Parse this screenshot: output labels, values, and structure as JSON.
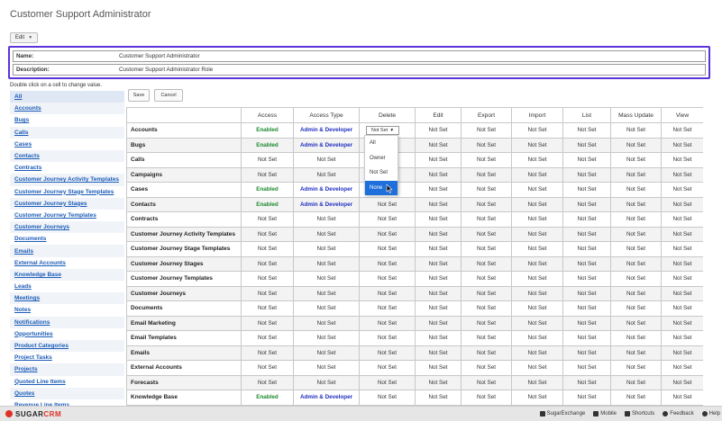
{
  "page_title": "Customer Support Administrator",
  "edit_button": {
    "label": "Edit"
  },
  "role": {
    "name_label": "Name:",
    "name_value": "Customer Support Administrator",
    "description_label": "Description:",
    "description_value": "Customer Support Administrator Role"
  },
  "hint": "Double click on a cell to change value.",
  "actions": {
    "save": "Save",
    "cancel": "Cancel"
  },
  "sidebar": {
    "items": [
      "All",
      "Accounts",
      "Bugs",
      "Calls",
      "Cases",
      "Contacts",
      "Contracts",
      "Customer Journey Activity Templates",
      "Customer Journey Stage Templates",
      "Customer Journey Stages",
      "Customer Journey Templates",
      "Customer Journeys",
      "Documents",
      "Emails",
      "External Accounts",
      "Knowledge Base",
      "Leads",
      "Meetings",
      "Notes",
      "Notifications",
      "Opportunities",
      "Product Categories",
      "Project Tasks",
      "Projects",
      "Quoted Line Items",
      "Quotes",
      "Revenue Line Items"
    ]
  },
  "grid": {
    "columns": [
      "",
      "Access",
      "Access Type",
      "Delete",
      "Edit",
      "Export",
      "Import",
      "List",
      "Mass Update",
      "View"
    ],
    "rows": [
      [
        "Accounts",
        "Enabled",
        "Admin & Developer",
        "",
        "Not Set",
        "Not Set",
        "Not Set",
        "Not Set",
        "Not Set",
        "Not Set"
      ],
      [
        "Bugs",
        "Enabled",
        "Admin & Developer",
        "",
        "Not Set",
        "Not Set",
        "Not Set",
        "Not Set",
        "Not Set",
        "Not Set"
      ],
      [
        "Calls",
        "Not Set",
        "Not Set",
        "",
        "Not Set",
        "Not Set",
        "Not Set",
        "Not Set",
        "Not Set",
        "Not Set"
      ],
      [
        "Campaigns",
        "Not Set",
        "Not Set",
        "",
        "Not Set",
        "Not Set",
        "Not Set",
        "Not Set",
        "Not Set",
        "Not Set"
      ],
      [
        "Cases",
        "Enabled",
        "Admin & Developer",
        "",
        "Not Set",
        "Not Set",
        "Not Set",
        "Not Set",
        "Not Set",
        "Not Set"
      ],
      [
        "Contacts",
        "Enabled",
        "Admin & Developer",
        "Not Set",
        "Not Set",
        "Not Set",
        "Not Set",
        "Not Set",
        "Not Set",
        "Not Set"
      ],
      [
        "Contracts",
        "Not Set",
        "Not Set",
        "Not Set",
        "Not Set",
        "Not Set",
        "Not Set",
        "Not Set",
        "Not Set",
        "Not Set"
      ],
      [
        "Customer Journey Activity Templates",
        "Not Set",
        "Not Set",
        "Not Set",
        "Not Set",
        "Not Set",
        "Not Set",
        "Not Set",
        "Not Set",
        "Not Set"
      ],
      [
        "Customer Journey Stage Templates",
        "Not Set",
        "Not Set",
        "Not Set",
        "Not Set",
        "Not Set",
        "Not Set",
        "Not Set",
        "Not Set",
        "Not Set"
      ],
      [
        "Customer Journey Stages",
        "Not Set",
        "Not Set",
        "Not Set",
        "Not Set",
        "Not Set",
        "Not Set",
        "Not Set",
        "Not Set",
        "Not Set"
      ],
      [
        "Customer Journey Templates",
        "Not Set",
        "Not Set",
        "Not Set",
        "Not Set",
        "Not Set",
        "Not Set",
        "Not Set",
        "Not Set",
        "Not Set"
      ],
      [
        "Customer Journeys",
        "Not Set",
        "Not Set",
        "Not Set",
        "Not Set",
        "Not Set",
        "Not Set",
        "Not Set",
        "Not Set",
        "Not Set"
      ],
      [
        "Documents",
        "Not Set",
        "Not Set",
        "Not Set",
        "Not Set",
        "Not Set",
        "Not Set",
        "Not Set",
        "Not Set",
        "Not Set"
      ],
      [
        "Email Marketing",
        "Not Set",
        "Not Set",
        "Not Set",
        "Not Set",
        "Not Set",
        "Not Set",
        "Not Set",
        "Not Set",
        "Not Set"
      ],
      [
        "Email Templates",
        "Not Set",
        "Not Set",
        "Not Set",
        "Not Set",
        "Not Set",
        "Not Set",
        "Not Set",
        "Not Set",
        "Not Set"
      ],
      [
        "Emails",
        "Not Set",
        "Not Set",
        "Not Set",
        "Not Set",
        "Not Set",
        "Not Set",
        "Not Set",
        "Not Set",
        "Not Set"
      ],
      [
        "External Accounts",
        "Not Set",
        "Not Set",
        "Not Set",
        "Not Set",
        "Not Set",
        "Not Set",
        "Not Set",
        "Not Set",
        "Not Set"
      ],
      [
        "Forecasts",
        "Not Set",
        "Not Set",
        "Not Set",
        "Not Set",
        "Not Set",
        "Not Set",
        "Not Set",
        "Not Set",
        "Not Set"
      ],
      [
        "Knowledge Base",
        "Enabled",
        "Admin & Developer",
        "Not Set",
        "Not Set",
        "Not Set",
        "Not Set",
        "Not Set",
        "Not Set",
        "Not Set"
      ]
    ]
  },
  "delete_dropdown": {
    "selected": "Not Set",
    "options": [
      "All",
      "Owner",
      "Not Set",
      "None"
    ],
    "highlighted": "None"
  },
  "footer": {
    "logo_sugar": "SUGAR",
    "logo_crm": "CRM",
    "links": [
      "SugarExchange",
      "Mobile",
      "Shortcuts",
      "Feedback",
      "Help"
    ]
  },
  "colors": {
    "accent_border": "#5a34d8",
    "enabled": "#1d8a2e",
    "admin": "#1f2fbf",
    "highlight": "#1e6fdb",
    "brand": "#e03127"
  }
}
